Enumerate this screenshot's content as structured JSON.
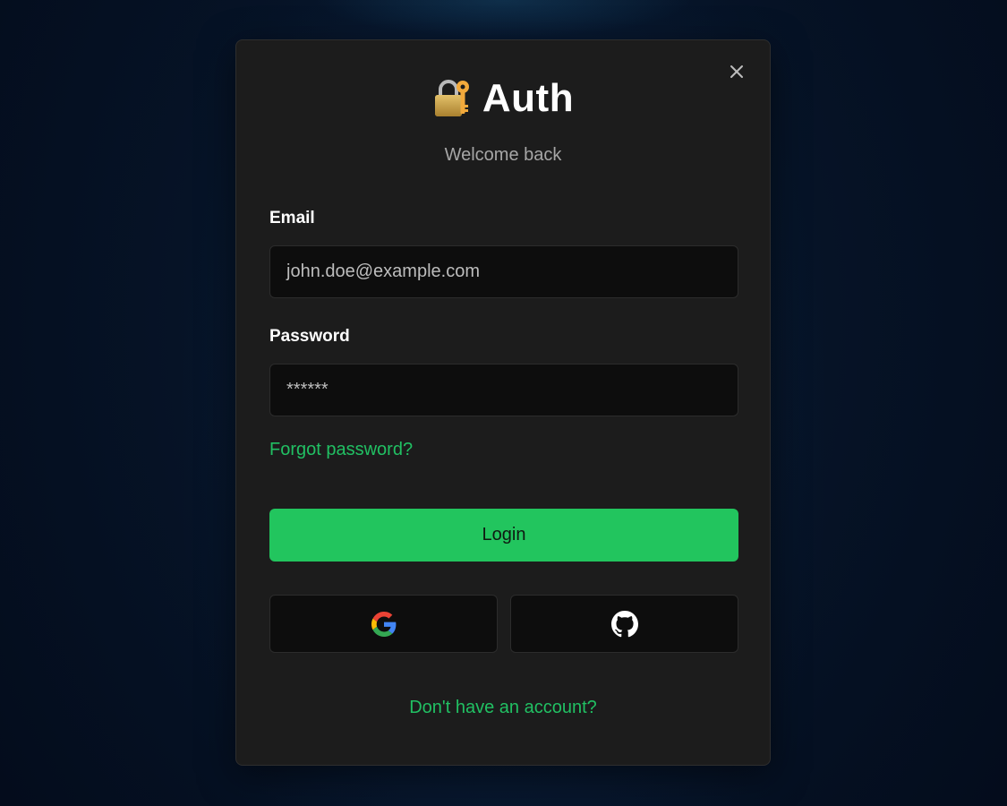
{
  "modal": {
    "title": "Auth",
    "title_icon": "lock-with-key-icon",
    "subtitle": "Welcome back",
    "close_icon": "close-icon"
  },
  "form": {
    "email_label": "Email",
    "email_value": "john.doe@example.com",
    "password_label": "Password",
    "password_value": "******",
    "forgot_link": "Forgot password?",
    "login_label": "Login"
  },
  "social": [
    {
      "name": "google",
      "icon": "google-icon"
    },
    {
      "name": "github",
      "icon": "github-icon"
    }
  ],
  "footer": {
    "signup_link": "Don't have an account?"
  },
  "colors": {
    "accent": "#22c55e",
    "link": "#21c063",
    "modal_bg": "#1c1c1c",
    "input_bg": "#0d0d0d",
    "page_bg": "#061428"
  }
}
